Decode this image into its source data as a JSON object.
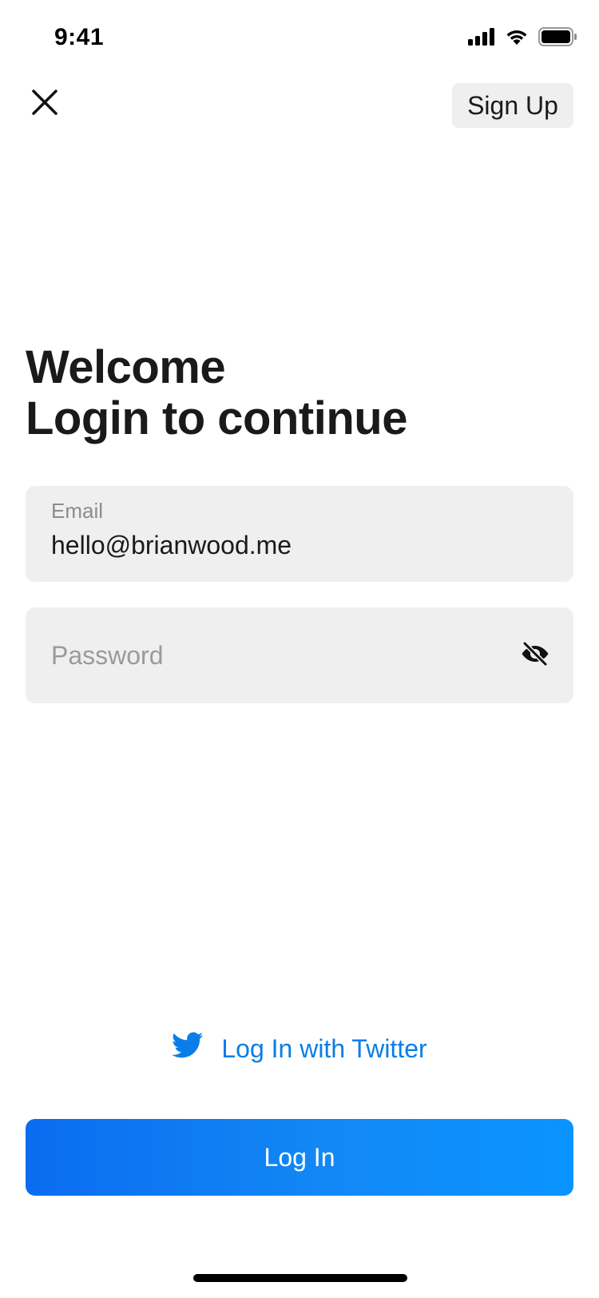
{
  "status_bar": {
    "time": "9:41",
    "icons": [
      "cellular-signal-icon",
      "wifi-icon",
      "battery-icon"
    ]
  },
  "nav": {
    "close_icon": "close-icon",
    "signup_label": "Sign Up"
  },
  "heading": {
    "line1": "Welcome",
    "line2": "Login to continue"
  },
  "form": {
    "email": {
      "label": "Email",
      "value": "hello@brianwood.me"
    },
    "password": {
      "placeholder": "Password",
      "toggle_icon": "eye-off-icon"
    }
  },
  "twitter_login": {
    "label": "Log In with Twitter",
    "icon": "twitter-icon",
    "color": "#0a7de8"
  },
  "login_button": {
    "label": "Log In",
    "color_start": "#0a6cf0",
    "color_end": "#0a94ff"
  }
}
